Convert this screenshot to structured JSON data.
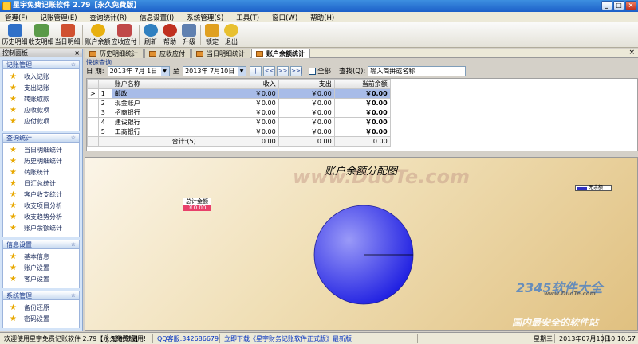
{
  "window": {
    "title": "星宇免费记账软件 2.79【永久免费版】",
    "min": "_",
    "max": "□",
    "close": "×"
  },
  "menu": [
    "管理(F)",
    "记账管理(E)",
    "查询统计(R)",
    "信息设置(I)",
    "系统管理(S)",
    "工具(T)",
    "窗口(W)",
    "帮助(H)"
  ],
  "toolbar": [
    {
      "label": "历史明细",
      "icon": "history-icon",
      "color": "#3070c8"
    },
    {
      "label": "收支明细",
      "icon": "ledger-icon",
      "color": "#5a9a48"
    },
    {
      "label": "当日明细",
      "icon": "calendar-icon",
      "color": "#d05030"
    },
    {
      "label": "账户余额",
      "icon": "star-icon",
      "color": "#e8b010"
    },
    {
      "label": "应收应付",
      "icon": "receivable-icon",
      "color": "#c04848"
    },
    {
      "label": "刷新",
      "icon": "refresh-icon",
      "color": "#3080c0"
    },
    {
      "label": "帮助",
      "icon": "help-icon",
      "color": "#c03020"
    },
    {
      "label": "升级",
      "icon": "upgrade-icon",
      "color": "#6080b0"
    },
    {
      "label": "锁定",
      "icon": "lock-icon",
      "color": "#e0a020"
    },
    {
      "label": "退出",
      "icon": "exit-icon",
      "color": "#e8c030"
    }
  ],
  "panel": {
    "title": "控制面板",
    "close": "×",
    "groups": [
      {
        "title": "记账管理",
        "items": [
          "收入记账",
          "支出记账",
          "转账取款",
          "应收款项",
          "应付款项"
        ]
      },
      {
        "title": "查询统计",
        "items": [
          "当日明细统计",
          "历史明细统计",
          "转账统计",
          "日汇总统计",
          "客户收支统计",
          "收支项目分析",
          "收支趋势分析",
          "账户余额统计"
        ]
      },
      {
        "title": "信息设置",
        "items": [
          "基本信息",
          "账户设置",
          "客户设置"
        ]
      },
      {
        "title": "系统管理",
        "items": [
          "备份还原",
          "密码设置"
        ]
      }
    ],
    "chevron": "☆"
  },
  "tabs": [
    {
      "label": "历史明细统计",
      "active": false
    },
    {
      "label": "应收应付",
      "active": false
    },
    {
      "label": "当日明细统计",
      "active": false
    },
    {
      "label": "账户余额统计",
      "active": true
    }
  ],
  "tab_close": "×",
  "tab_active_mark": "×",
  "query": {
    "section_title": "快速查询",
    "date_label": "日 期:",
    "date_from": "2013年 7月 1日",
    "to_label": "至",
    "date_to": "2013年 7月10日",
    "nav_buttons": [
      "|<<",
      "<<",
      ">>",
      ">>|"
    ],
    "all_label": "全部",
    "search_label": "查找(Q):",
    "search_placeholder": "输入简拼或名称"
  },
  "grid": {
    "columns": [
      "账户名称",
      "收入",
      "支出",
      "当前余额"
    ],
    "rows": [
      {
        "indicator": ">",
        "no": "1",
        "name": "邮政",
        "income": "￥0.00",
        "expense": "￥0.00",
        "balance": "￥0.00"
      },
      {
        "indicator": "",
        "no": "2",
        "name": "现金账户",
        "income": "￥0.00",
        "expense": "￥0.00",
        "balance": "￥0.00"
      },
      {
        "indicator": "",
        "no": "3",
        "name": "招商银行",
        "income": "￥0.00",
        "expense": "￥0.00",
        "balance": "￥0.00"
      },
      {
        "indicator": "",
        "no": "4",
        "name": "建设银行",
        "income": "￥0.00",
        "expense": "￥0.00",
        "balance": "￥0.00"
      },
      {
        "indicator": "",
        "no": "5",
        "name": "工商银行",
        "income": "￥0.00",
        "expense": "￥0.00",
        "balance": "￥0.00"
      }
    ],
    "total": {
      "label": "合计:(5)",
      "income": "0.00",
      "expense": "0.00",
      "balance": "0.00"
    }
  },
  "chart_data": {
    "type": "pie",
    "title": "账户余额分配图",
    "categories": [
      "无余额"
    ],
    "values": [
      100
    ],
    "legend": "top-right",
    "annotation": {
      "line1": "总计金额",
      "line2": "￥0.00"
    },
    "colors": {
      "slice_light": "#9a9af8",
      "slice_dark": "#1818e0"
    }
  },
  "watermark": {
    "center": "www.DuoTe.com",
    "logo": "2345软件大全",
    "site": "www.DuoTe.com",
    "slogan": "国内最安全的软件站"
  },
  "status": {
    "welcome": "欢迎使用星宇免费记账软件 2.79【永久免费版】",
    "thanks": "感谢您使用!",
    "qq": "QQ客服:342686679",
    "download": "立即下载《星宇财务记账软件正式版》最新版",
    "weekday": "星期三",
    "datetime": "2013年07月10日",
    "time": "10:10:57"
  }
}
